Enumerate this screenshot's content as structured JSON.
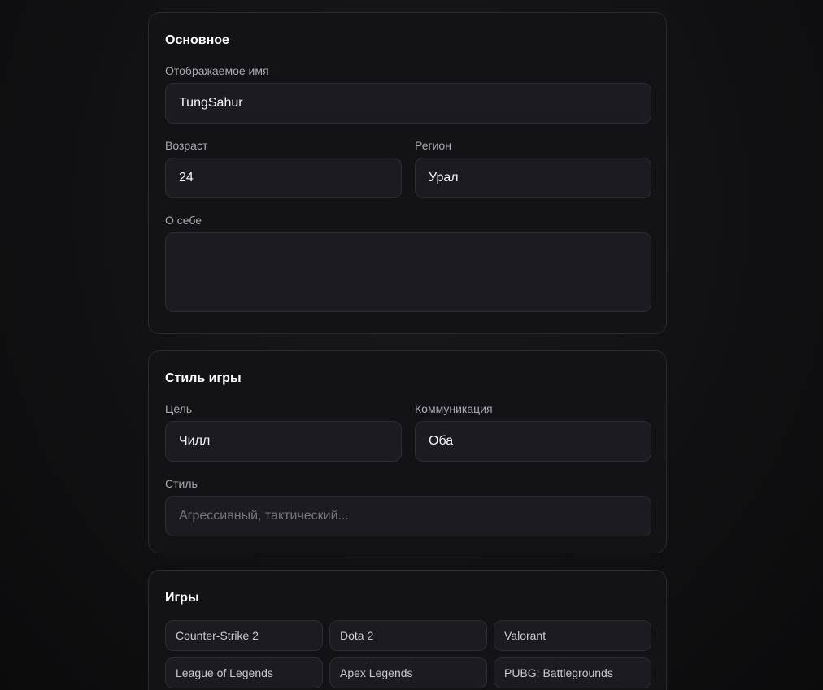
{
  "basic": {
    "title": "Основное",
    "display_name_label": "Отображаемое имя",
    "display_name_value": "TungSahur",
    "age_label": "Возраст",
    "age_value": "24",
    "region_label": "Регион",
    "region_value": "Урал",
    "about_label": "О себе",
    "about_value": ""
  },
  "playstyle": {
    "title": "Стиль игры",
    "goal_label": "Цель",
    "goal_value": "Чилл",
    "communication_label": "Коммуникация",
    "communication_value": "Оба",
    "style_label": "Стиль",
    "style_placeholder": "Агрессивный, тактический..."
  },
  "games": {
    "title": "Игры",
    "items": [
      "Counter-Strike 2",
      "Dota 2",
      "Valorant",
      "League of Legends",
      "Apex Legends",
      "PUBG: Battlegrounds"
    ]
  }
}
